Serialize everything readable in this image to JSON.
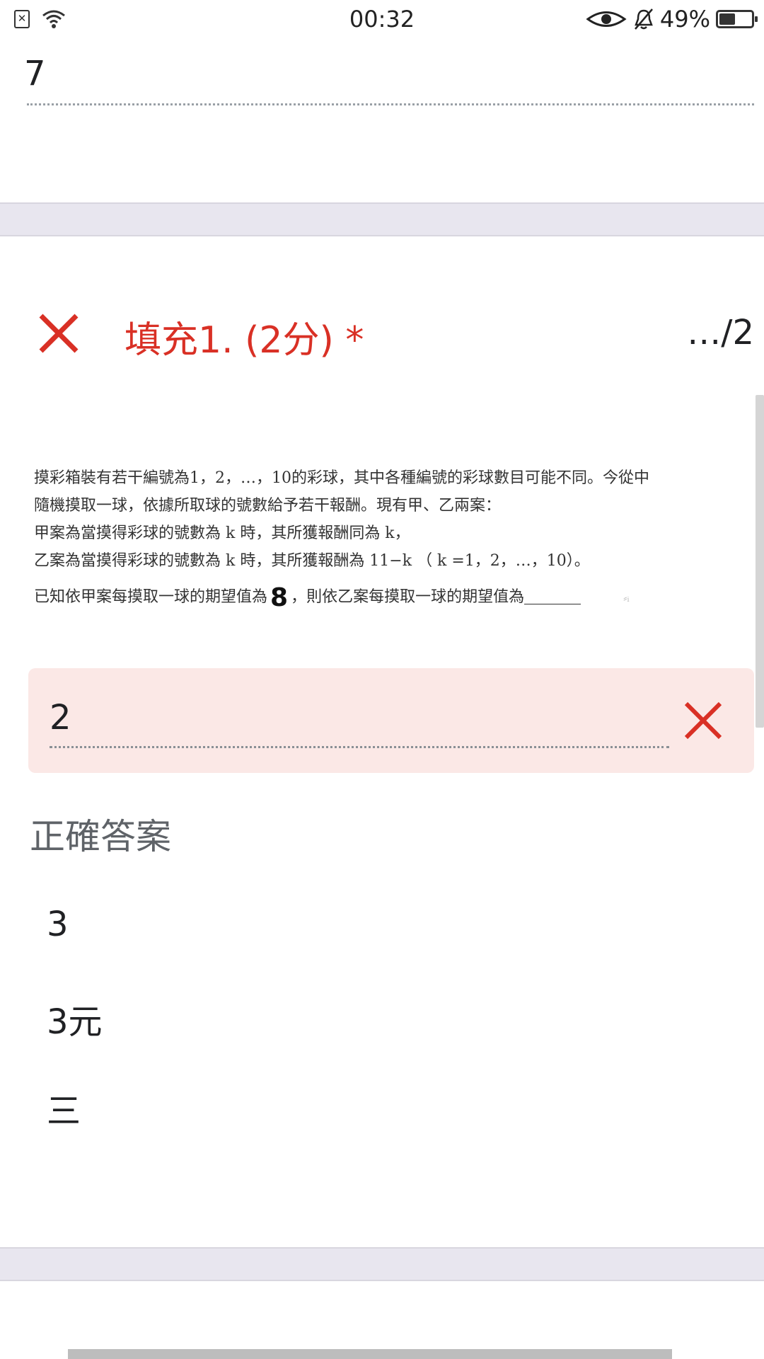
{
  "status_bar": {
    "time": "00:32",
    "battery_percent": "49%",
    "battery_level": 0.49,
    "icons": [
      "sim-error-icon",
      "wifi-icon",
      "eye-icon",
      "bell-muted-icon",
      "battery-icon"
    ]
  },
  "previous_question": {
    "answer": "7"
  },
  "question": {
    "title": "填充1. (2分) *",
    "score": "…/2",
    "status_icon": "close-icon",
    "lines": [
      "摸彩箱裝有若干編號為1，2，…，10的彩球，其中各種編號的彩球數目可能不同。今從中",
      "隨機摸取一球，依據所取球的號數給予若干報酬。現有甲、乙兩案：",
      "甲案為當摸得彩球的號數為 k 時，其所獲報酬同為 k，",
      "乙案為當摸得彩球的號數為 k 時，其所獲報酬為 11−k （ k =1，2，…，10）。"
    ],
    "last_line_before": "已知依甲案每摸取一球的期望值為",
    "handwritten_value": "8",
    "last_line_after": "，則依乙案每摸取一球的期望值為"
  },
  "user_answer": {
    "value": "2",
    "result_icon": "close-icon"
  },
  "correct_answers": {
    "label": "正確答案",
    "items": [
      "3",
      "3元",
      "三"
    ]
  },
  "colors": {
    "error_red": "#d93025",
    "answer_bg": "#fbe8e6",
    "separator": "#e8e6ef"
  }
}
